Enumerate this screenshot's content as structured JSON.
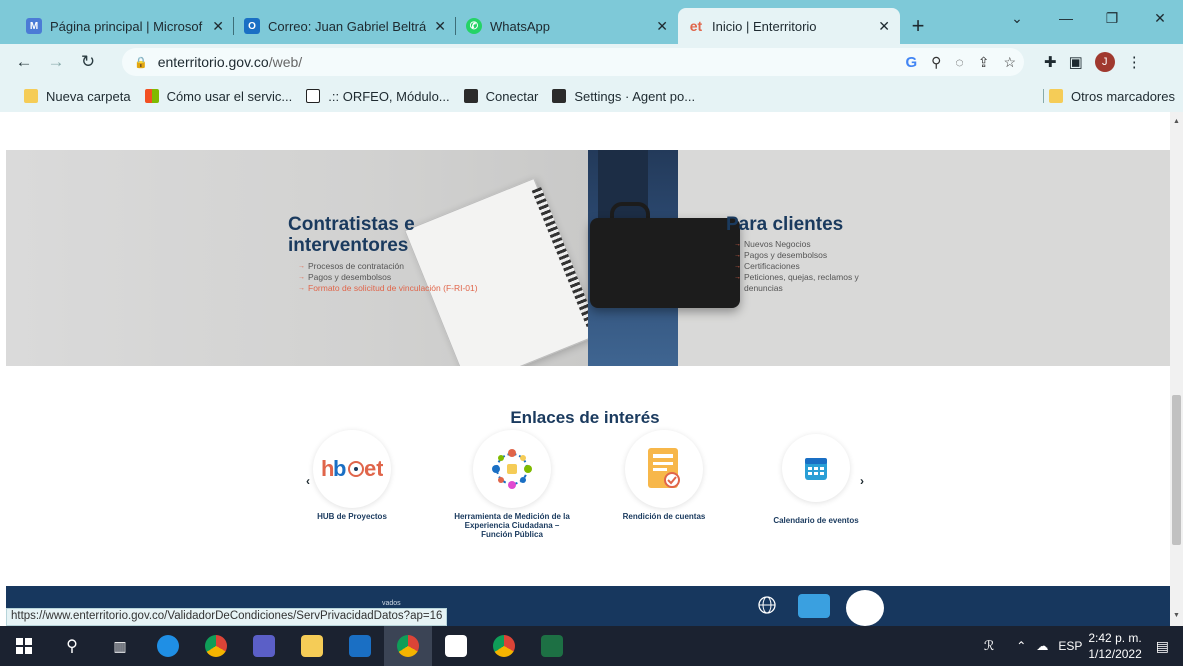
{
  "browser": {
    "tabs": [
      {
        "title": "Página principal | Microsof",
        "favicon": "microsoft-icon",
        "color": "#4b7bd6"
      },
      {
        "title": "Correo: Juan Gabriel Beltrá",
        "favicon": "outlook-icon",
        "color": "#1a6fc4"
      },
      {
        "title": "WhatsApp",
        "favicon": "whatsapp-icon",
        "color": "#25d366"
      },
      {
        "title": "Inicio | Enterritorio",
        "favicon": "enterritorio-icon",
        "color": "#e0654a",
        "active": true
      }
    ],
    "new_tab": "+",
    "address": {
      "host": "enterritorio.gov.co",
      "path": "/web/"
    },
    "bookmarks": [
      {
        "label": "Nueva carpeta",
        "icon": "folder-icon"
      },
      {
        "label": "Cómo usar el servic...",
        "icon": "microsoft-icon"
      },
      {
        "label": ".:: ORFEO, Módulo...",
        "icon": "orfeo-icon"
      },
      {
        "label": "Conectar",
        "icon": "conectar-icon"
      },
      {
        "label": "Settings · Agent po...",
        "icon": "conectar-icon"
      }
    ],
    "other_bookmarks": "Otros marcadores",
    "avatar_letter": "J"
  },
  "page": {
    "contractors": {
      "title": "Contratistas e interventores",
      "items": [
        "Procesos de contratación",
        "Pagos y desembolsos",
        "Formato de solicitud de vinculación (F-RI-01)"
      ]
    },
    "clients": {
      "title": "Para clientes",
      "items": [
        "Nuevos Negocios",
        "Pagos y desembolsos",
        "Certificaciones",
        "Peticiones, quejas, reclamos y denuncias"
      ]
    },
    "links_title": "Enlaces de interés",
    "links": [
      {
        "label": "HUB de Proyectos",
        "icon": "hub-logo-icon"
      },
      {
        "label": "Herramienta de Medición de la Experiencia Ciudadana – Función Pública",
        "icon": "network-people-icon"
      },
      {
        "label": "Rendición de cuentas",
        "icon": "document-check-icon"
      },
      {
        "label": "Calendario de eventos",
        "icon": "calendar-icon"
      }
    ],
    "footer_rights": "vados",
    "status_url": "https://www.enterritorio.gov.co/ValidadorDeCondiciones/ServPrivacidadDatos?ap=16"
  },
  "taskbar": {
    "language": "ESP",
    "time": "2:42 p. m.",
    "date": "1/12/2022"
  },
  "colors": {
    "brand_navy": "#1a3a5e",
    "accent_orange": "#e0654a",
    "chrome_teal": "#7ec9d8"
  }
}
